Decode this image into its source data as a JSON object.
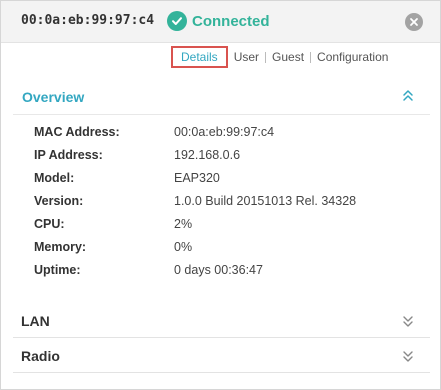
{
  "header": {
    "mac": "00:0a:eb:99:97:c4",
    "status": "Connected",
    "status_color": "#33b39a",
    "close_icon": "close-icon",
    "status_icon": "check-circle-icon"
  },
  "tabs": [
    {
      "label": "Details",
      "active": true
    },
    {
      "label": "User",
      "active": false
    },
    {
      "label": "Guest",
      "active": false
    },
    {
      "label": "Configuration",
      "active": false
    }
  ],
  "overview": {
    "title": "Overview",
    "accent": "#33a7c1",
    "rows": [
      {
        "label": "MAC Address:",
        "value": "00:0a:eb:99:97:c4"
      },
      {
        "label": "IP Address:",
        "value": "192.168.0.6"
      },
      {
        "label": "Model:",
        "value": "EAP320"
      },
      {
        "label": "Version:",
        "value": "1.0.0 Build 20151013 Rel. 34328"
      },
      {
        "label": "CPU:",
        "value": "2%"
      },
      {
        "label": "Memory:",
        "value": "0%"
      },
      {
        "label": "Uptime:",
        "value": "0 days 00:36:47"
      }
    ]
  },
  "sections": {
    "lan": {
      "title": "LAN"
    },
    "radio": {
      "title": "Radio"
    }
  }
}
